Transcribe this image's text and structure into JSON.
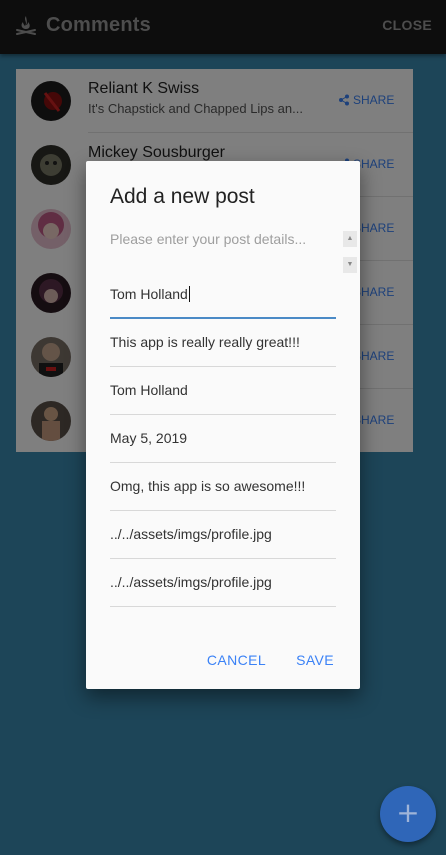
{
  "header": {
    "icon": "campfire-icon",
    "title": "Comments",
    "close_label": "CLOSE"
  },
  "comments": [
    {
      "name": "Reliant K Swiss",
      "preview": "It's Chapstick and Chapped Lips an...",
      "share_label": "SHARE",
      "avatar_color": "#1c1c1c"
    },
    {
      "name": "Mickey Sousburger",
      "preview": "",
      "share_label": "SHARE",
      "avatar_color": "#3a3a30"
    },
    {
      "name": "",
      "preview": "",
      "share_label": "SHARE",
      "avatar_color": "#b86a8a"
    },
    {
      "name": "",
      "preview": "",
      "share_label": "SHARE",
      "avatar_color": "#4a2a3a"
    },
    {
      "name": "",
      "preview": "",
      "share_label": "SHARE",
      "avatar_color": "#6a5a50"
    },
    {
      "name": "",
      "preview": "",
      "share_label": "SHARE",
      "avatar_color": "#4a4038"
    }
  ],
  "dialog": {
    "title": "Add a new post",
    "details_placeholder": "Please enter your post details...",
    "fields": [
      {
        "value": "Tom Holland"
      },
      {
        "value": "This app is really really great!!!"
      },
      {
        "value": "Tom Holland"
      },
      {
        "value": "May 5, 2019"
      },
      {
        "value": "Omg, this app is so awesome!!!"
      },
      {
        "value": "../../assets/imgs/profile.jpg"
      },
      {
        "value": "../../assets/imgs/profile.jpg"
      }
    ],
    "cancel_label": "CANCEL",
    "save_label": "SAVE"
  },
  "fab": {
    "icon": "plus-icon",
    "label": "+"
  },
  "colors": {
    "background": "#3b8ab0",
    "header": "#1a1a1a",
    "accent": "#3b82f6",
    "fab": "#2f66b8"
  }
}
